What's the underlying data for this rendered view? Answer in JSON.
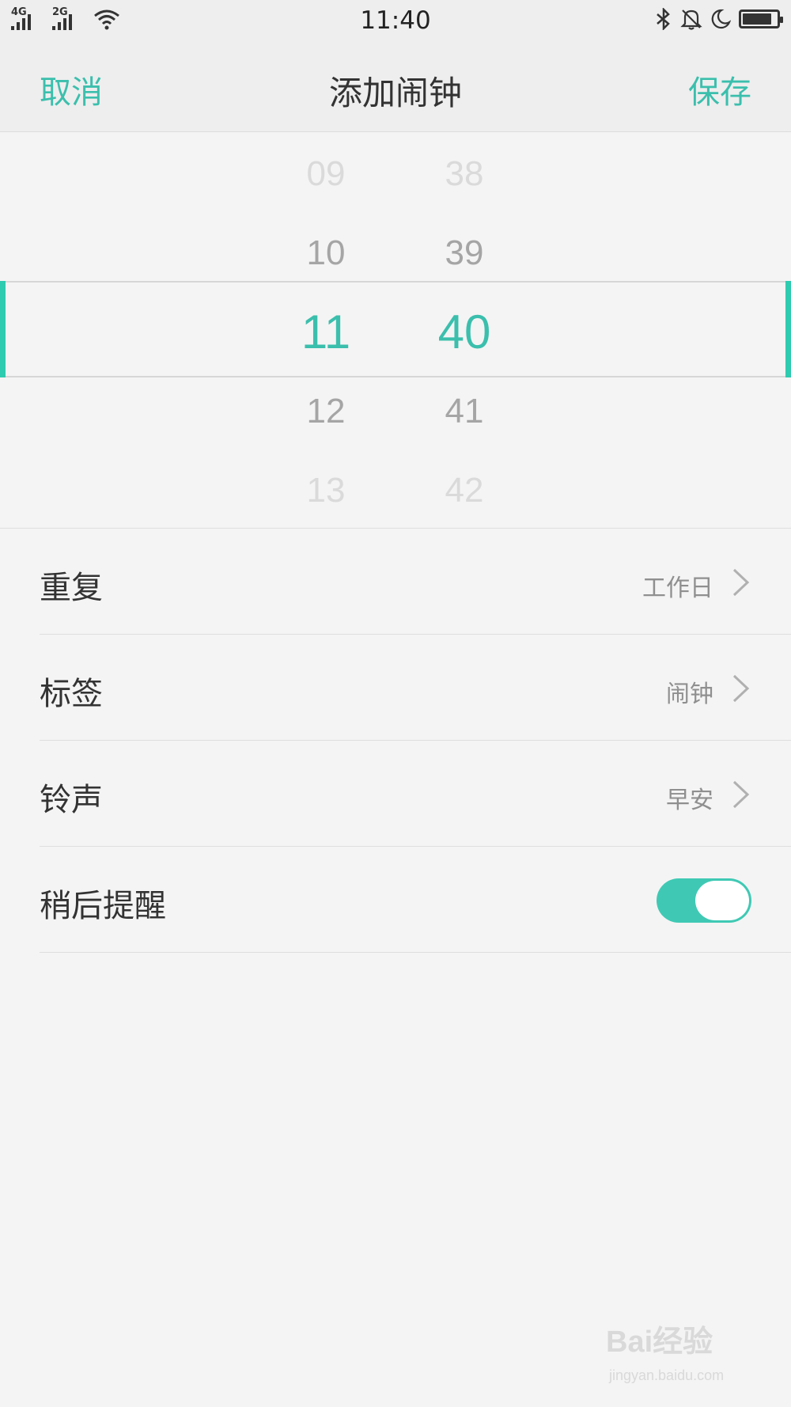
{
  "status_bar": {
    "network_1": "4G",
    "network_2": "2G",
    "time": "11:40",
    "icons": [
      "signal-icon",
      "wifi-icon",
      "bluetooth-icon",
      "bell-off-icon",
      "moon-icon",
      "battery-icon"
    ],
    "battery_level": 0.85
  },
  "nav": {
    "cancel_label": "取消",
    "title": "添加闹钟",
    "save_label": "保存"
  },
  "time_picker": {
    "hours": [
      "09",
      "10",
      "11",
      "12",
      "13"
    ],
    "minutes": [
      "38",
      "39",
      "40",
      "41",
      "42"
    ],
    "selected_hour": "11",
    "selected_minute": "40"
  },
  "settings": [
    {
      "label": "重复",
      "value": "工作日"
    },
    {
      "label": "标签",
      "value": "闹钟"
    },
    {
      "label": "铃声",
      "value": "早安"
    }
  ],
  "snooze": {
    "label": "稍后提醒",
    "enabled": true
  },
  "watermark": {
    "brand": "Bai经验",
    "url": "jingyan.baidu.com"
  },
  "colors": {
    "accent": "#3bbfad",
    "toggle_on": "#3fc9b4",
    "background": "#f4f4f4"
  }
}
